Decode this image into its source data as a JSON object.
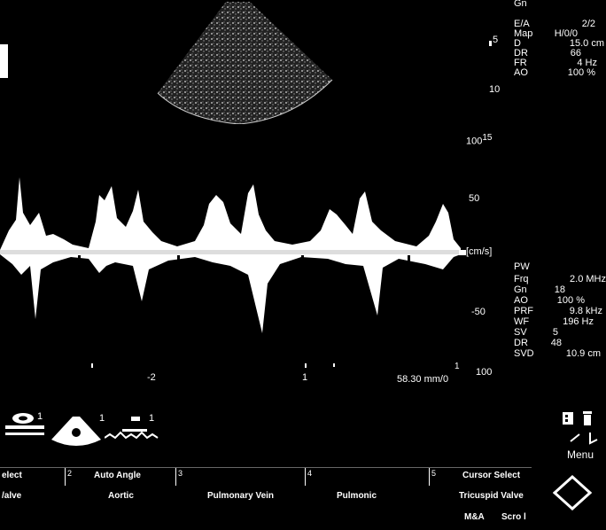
{
  "top_params": {
    "depth_marks": [
      "5",
      "10"
    ],
    "labels": [
      "Gn",
      "E/A",
      "Map",
      "D",
      "DR",
      "FR",
      "AO"
    ],
    "values": [
      "",
      "2/2",
      "H/0/0",
      "15.0 cm",
      "66",
      "4 Hz",
      "100 %"
    ]
  },
  "scale_100_15": "100",
  "scale_100_15_sup": "15",
  "doppler": {
    "scale_labels": [
      "50",
      "-50",
      "100"
    ],
    "unit_label": "[cm/s]",
    "marker_neg2": "-2",
    "marker_1": "1",
    "sweep_speed": "58.30 mm/0",
    "sweep_sup": "1"
  },
  "pw_params": {
    "title": "PW",
    "labels": [
      "Frq",
      "Gn",
      "AO",
      "PRF",
      "WF",
      "SV",
      "DR",
      "SVD"
    ],
    "values": [
      "2.0 MHz",
      "18",
      "100 %",
      "9.8 kHz",
      "196 Hz",
      "5",
      "48",
      "10.9 cm"
    ]
  },
  "thumbnails": {
    "marks": [
      "1",
      "1",
      "1"
    ]
  },
  "menu": {
    "label": "Menu"
  },
  "softkeys": {
    "row1": [
      {
        "num": "",
        "label": "elect"
      },
      {
        "num": "2",
        "label": "Auto Angle"
      },
      {
        "num": "3",
        "label": ""
      },
      {
        "num": "4",
        "label": ""
      },
      {
        "num": "5",
        "label": "Cursor Select"
      }
    ],
    "row2": [
      "/alve",
      "Aortic",
      "Pulmonary Vein",
      "Pulmonic",
      "Tricuspid Valve"
    ],
    "row3": [
      "M&A",
      "Scro l"
    ]
  }
}
